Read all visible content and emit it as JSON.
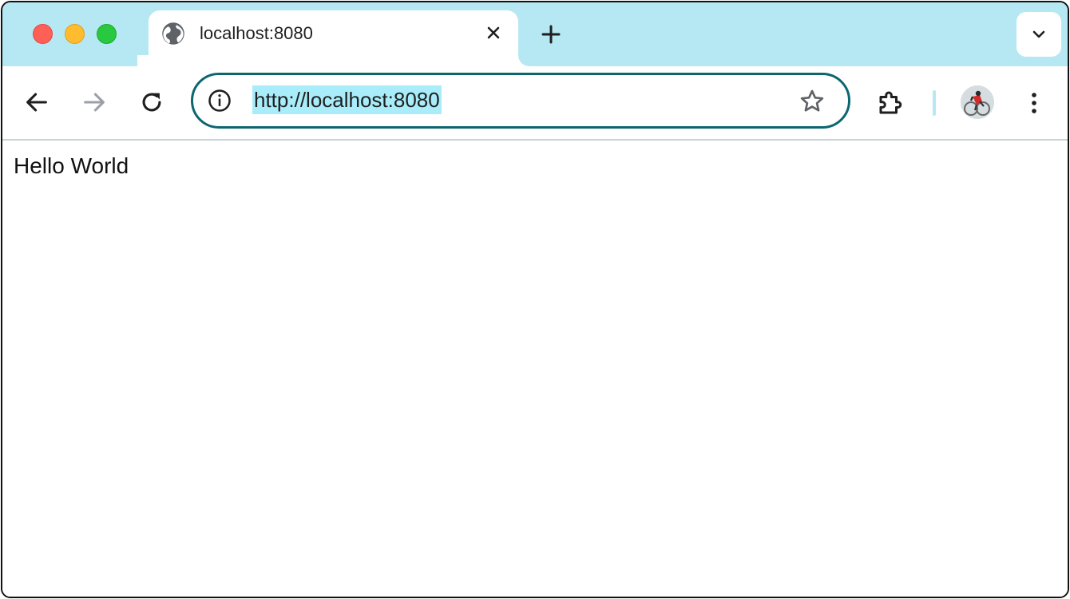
{
  "window": {
    "traffic_lights": [
      "close",
      "minimize",
      "zoom"
    ],
    "colors": {
      "close": "#fe5f57",
      "minimize": "#febc2e",
      "zoom": "#28c840",
      "tabstrip": "#b6e8f3",
      "omnibox_border": "#0b6670",
      "selection": "#a8edf9"
    }
  },
  "tab": {
    "title": "localhost:8080",
    "favicon": "globe-icon",
    "close_icon": "close-icon"
  },
  "tabstrip": {
    "new_tab_icon": "plus-icon",
    "tab_search_icon": "chevron-down-icon"
  },
  "toolbar": {
    "back_icon": "arrow-left-icon",
    "forward_icon": "arrow-right-icon",
    "reload_icon": "reload-icon",
    "site_info_icon": "info-icon",
    "url": "http://localhost:8080",
    "bookmark_icon": "star-icon",
    "extensions_icon": "puzzle-icon",
    "profile_icon": "avatar",
    "menu_icon": "more-vertical-icon"
  },
  "page": {
    "text": "Hello World"
  }
}
